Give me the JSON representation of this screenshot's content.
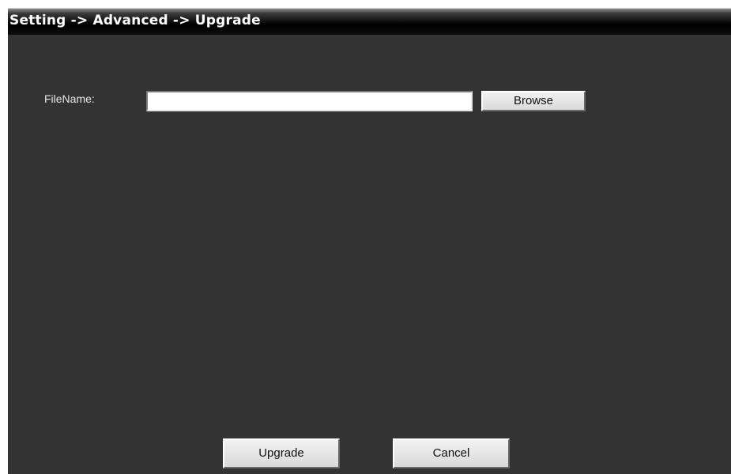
{
  "header": {
    "breadcrumb": "Setting -> Advanced -> Upgrade"
  },
  "form": {
    "filename_label": "FileName:",
    "filename_value": "",
    "browse_label": "Browse"
  },
  "actions": {
    "upgrade_label": "Upgrade",
    "cancel_label": "Cancel"
  },
  "colors": {
    "panel_background": "#333333",
    "titlebar_background": "#000000",
    "title_text": "#ffffff",
    "label_text": "#e6e6e6",
    "button_face": "#e6e6e6"
  }
}
